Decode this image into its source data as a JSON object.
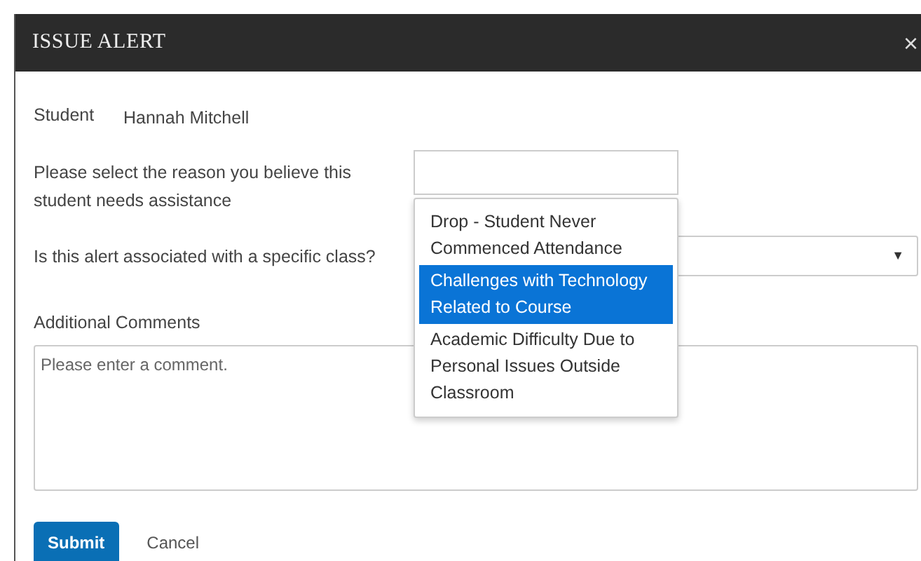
{
  "dialog": {
    "title": "ISSUE ALERT",
    "close": "×"
  },
  "student": {
    "label": "Student",
    "value": "Hannah Mitchell"
  },
  "reason": {
    "label": "Please select the reason you believe this student needs assistance",
    "expanded": true,
    "options": [
      {
        "label": "Drop - Student Never Commenced Attendance",
        "selected": false
      },
      {
        "label": "Challenges with Technology Related to Course",
        "selected": true
      },
      {
        "label": "Academic Difficulty Due to Personal Issues Outside Classroom",
        "selected": false
      }
    ]
  },
  "class_select": {
    "label": "Is this alert associated with a specific class?",
    "caret": "▼"
  },
  "comments": {
    "label": "Additional Comments",
    "placeholder": "Please enter a comment."
  },
  "buttons": {
    "submit": "Submit",
    "cancel": "Cancel"
  }
}
